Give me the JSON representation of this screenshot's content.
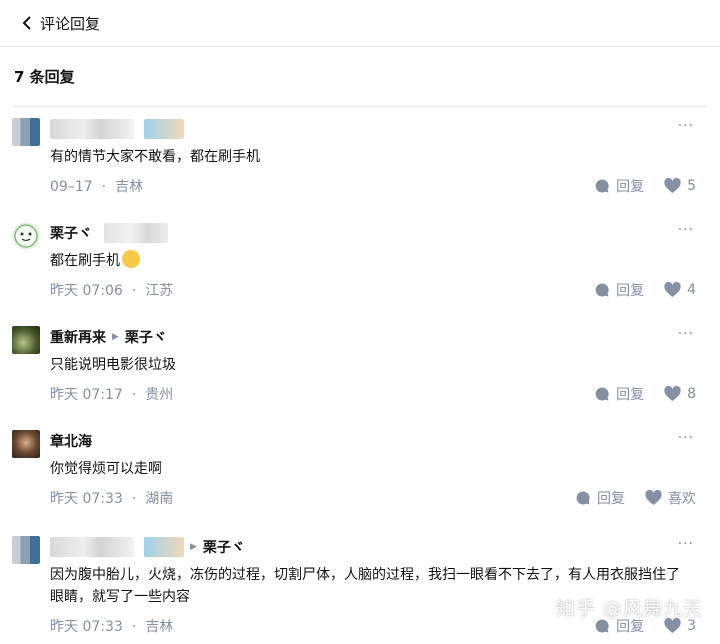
{
  "header": {
    "title": "评论回复"
  },
  "count_label": "7 条回复",
  "actions": {
    "reply_label": "回复",
    "more_label": "···"
  },
  "comments": [
    {
      "author": "",
      "reply_to": "",
      "content": "有的情节大家不敢看，都在刷手机",
      "time": "09–17",
      "location": "吉林",
      "likes": "5"
    },
    {
      "author": "栗子ヾ",
      "reply_to": "",
      "content": "都在刷手机",
      "time": "昨天 07:06",
      "location": "江苏",
      "likes": "4"
    },
    {
      "author": "重新再来",
      "reply_to": "栗子ヾ",
      "content": "只能说明电影很垃圾",
      "time": "昨天 07:17",
      "location": "贵州",
      "likes": "8"
    },
    {
      "author": "章北海",
      "reply_to": "",
      "content": "你觉得烦可以走啊",
      "time": "昨天 07:33",
      "location": "湖南",
      "likes": "喜欢"
    },
    {
      "author": "",
      "reply_to": "栗子ヾ",
      "content": "因为腹中胎儿，火烧，冻伤的过程，切割尸体，人脑的过程，我扫一眼看不下去了，有人用衣服挡住了眼睛，就写了一些内容",
      "time": "昨天 07:33",
      "location": "吉林",
      "likes": "3"
    }
  ],
  "watermark": "知乎 @风舞九天"
}
